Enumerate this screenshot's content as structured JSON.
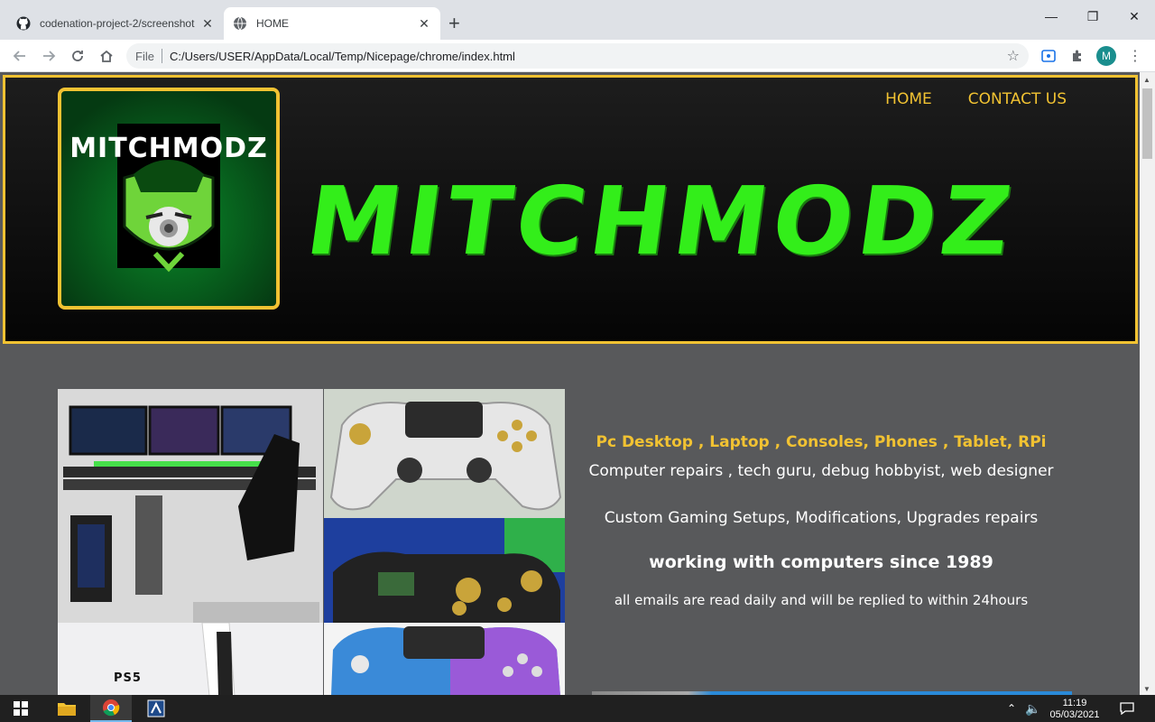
{
  "browser": {
    "tabs": [
      {
        "title": "codenation-project-2/screenshot",
        "favicon": "github-icon",
        "active": false
      },
      {
        "title": "HOME",
        "favicon": "globe-icon",
        "active": true
      }
    ],
    "url_scheme": "File",
    "url": "C:/Users/USER/AppData/Local/Temp/Nicepage/chrome/index.html",
    "profile_initial": "M"
  },
  "site": {
    "logo_text": "MITCHMODZ",
    "brand_title": "MITCHMODZ",
    "nav": [
      "HOME",
      "CONTACT US"
    ],
    "info": {
      "line1": "Pc Desktop , Laptop , Consoles, Phones , Tablet, RPi",
      "line2": "Computer repairs , tech guru, debug hobbyist, web designer",
      "line3": "Custom Gaming Setups, Modifications, Upgrades repairs",
      "line4": "working with computers since 1989",
      "line5": "all emails are read daily and will be replied to within 24hours"
    },
    "ps5_label": "PS5"
  },
  "taskbar": {
    "time": "11:19",
    "date": "05/03/2021"
  },
  "colors": {
    "accent": "#f1c232",
    "brand_green": "#33ee1a",
    "page_bg": "#58595b"
  }
}
